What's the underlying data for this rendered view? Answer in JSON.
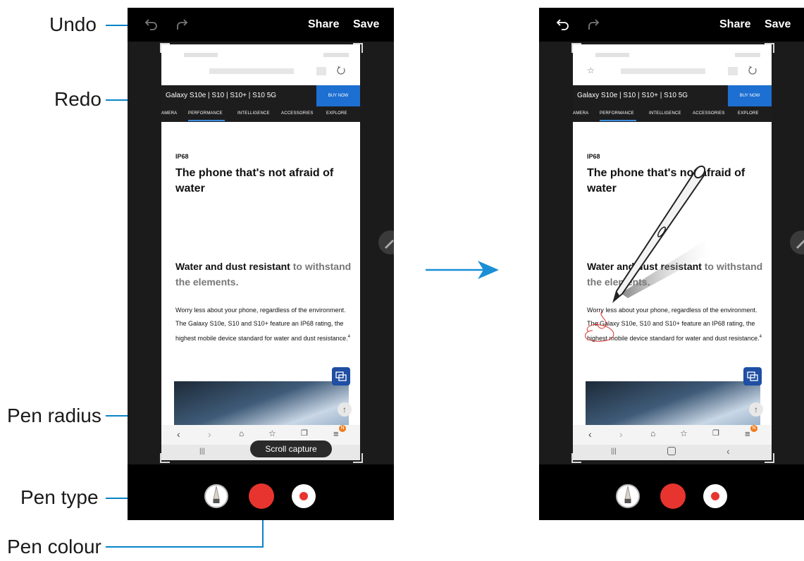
{
  "callouts": {
    "undo": "Undo",
    "redo": "Redo",
    "pen_radius": "Pen radius",
    "pen_type": "Pen type",
    "pen_colour": "Pen colour"
  },
  "toolbar": {
    "share_label": "Share",
    "save_label": "Save"
  },
  "webpage": {
    "banner_title": "Galaxy S10e | S10 | S10+ | S10 5G",
    "buy_now": "BUY NOW",
    "nav_items": [
      "AMERA",
      "PERFORMANCE",
      "INTELLIGENCE",
      "ACCESSORIES",
      "EXPLORE"
    ],
    "active_nav": "PERFORMANCE",
    "tag": "IP68",
    "headline": "The phone that's not afraid of water",
    "subhead_bold": "Water and dust resistant",
    "subhead_rest": " to withstand the elements.",
    "body": "Worry less about your phone, regardless of the environment. The Galaxy S10e, S10 and S10+ feature an IP68 rating, the highest mobile device standard for water and dust resistance.",
    "footnote": "4",
    "notification_badge": "N"
  },
  "scroll_capture_label": "Scroll capture",
  "colors": {
    "accent_line": "#0a84c6",
    "pen_colour": "#e8342f",
    "arrow": "#1a8fd6",
    "buy_button": "#1d6fd1",
    "nav_underline": "#3b8de0"
  },
  "icons": [
    "undo-icon",
    "redo-icon",
    "edit-pencil-icon",
    "chat-icon",
    "scroll-top-icon",
    "back-icon",
    "forward-icon",
    "home-icon",
    "bookmark-icon",
    "tabs-icon",
    "menu-icon",
    "recents-icon",
    "home-button-icon",
    "back-button-icon",
    "pen-type-icon",
    "arrow-right-icon",
    "s-pen-icon"
  ]
}
